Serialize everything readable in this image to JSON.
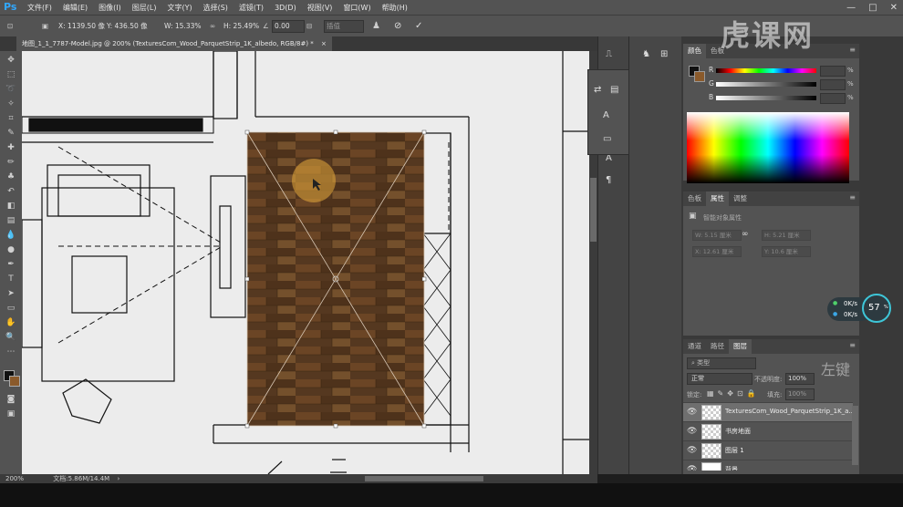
{
  "app": {
    "logo": "Ps"
  },
  "menu": [
    "文件(F)",
    "编辑(E)",
    "图像(I)",
    "图层(L)",
    "文字(Y)",
    "选择(S)",
    "滤镜(T)",
    "3D(D)",
    "视图(V)",
    "窗口(W)",
    "帮助(H)"
  ],
  "options": {
    "x": "X: 1139.50 像",
    "y": "Y: 436.50 像",
    "w": "W: 15.33%",
    "h": "H: 25.49%",
    "angle": "0.00",
    "interp": "插值",
    "commit_label": "✓",
    "cancel_label": "⊘"
  },
  "document": {
    "tab_label": "地图_1_1_7787-Model.jpg @ 200% (TexturesCom_Wood_ParquetStrip_1K_albedo, RGB/8#) *",
    "zoom": "200%",
    "doc_size": "文档:5.86M/14.4M"
  },
  "color_panel": {
    "tabs": [
      "颜色",
      "色板"
    ],
    "r_label": "R",
    "g_label": "G",
    "b_label": "B",
    "pct": "%"
  },
  "properties_panel": {
    "tabs": [
      "色板",
      "属性",
      "调整"
    ],
    "title": "智能对象属性",
    "w": "W: 5.15 厘米",
    "h": "H: 5.21 厘米",
    "x": "X: 12.61 厘米",
    "y": "Y: 10.6 厘米"
  },
  "layers_panel": {
    "tabs": [
      "通道",
      "路径",
      "图层"
    ],
    "filter": "类型",
    "blend_mode": "正常",
    "opacity_label": "不透明度:",
    "opacity": "100%",
    "lock_label": "锁定:",
    "fill_label": "填充:",
    "fill": "100%",
    "layers": [
      {
        "name": "TexturesCom_Wood_ParquetStrip_1K_a...",
        "selected": true
      },
      {
        "name": "书房地面",
        "selected": false
      },
      {
        "name": "图层 1",
        "selected": false
      },
      {
        "name": "背景",
        "selected": false
      }
    ]
  },
  "net_widget": {
    "up": "0K/s",
    "down": "0K/s",
    "percent": "57"
  },
  "watermark": {
    "main": "虎课网",
    "corner": "左键"
  }
}
